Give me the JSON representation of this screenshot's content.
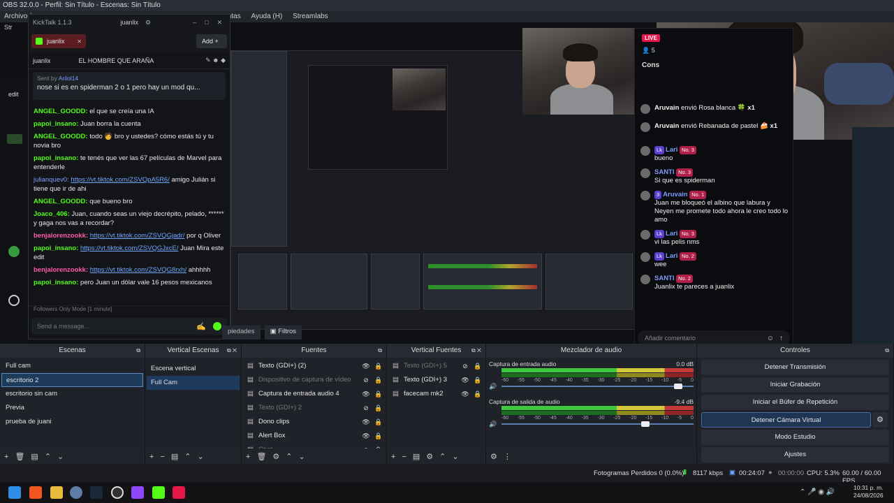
{
  "obs": {
    "title": "OBS 32.0.0 - Perfil: Sin Título - Escenas: Sin Título",
    "menu": [
      "Archivo (",
      "entas",
      "Ayuda (H)",
      "Streamlabs"
    ],
    "menu_partial_left": "Str",
    "preview_labels": {
      "edit_left": "edit"
    }
  },
  "kicktalk": {
    "title": "KickTalk 1.1.3",
    "user": "juanlix",
    "tab": "juanlix",
    "add": "Add",
    "channel": "juanlix",
    "stream_title": "EL HOMBRE QUE ARAÑA",
    "pinned_from_label": "Sent by",
    "pinned_from_user": "Arilol14",
    "pinned_text": "nose si es en spiderman 2 o 1 pero hay un mod qu...",
    "messages": [
      {
        "user": "ANGEL_GOODD:",
        "text": "el que se creía una IA",
        "link": ""
      },
      {
        "user": "papoi_insano:",
        "text": "Juan borra la cuenta",
        "link": ""
      },
      {
        "user": "ANGEL_GOODD:",
        "text": "todo 🧑 bro y ustedes? cómo estás tú y tu novia bro",
        "link": ""
      },
      {
        "user": "papoi_insano:",
        "text": "te tenés que ver las 67 películas de Marvel para entenderle",
        "link": ""
      },
      {
        "user": "julianquev0:",
        "text": "amigo Julián si tiene que ir de ahi",
        "link": "https://vt.tiktok.com/ZSVQpA5R6/"
      },
      {
        "user": "ANGEL_GOODD:",
        "text": "que bueno bro",
        "link": ""
      },
      {
        "user": "Joaco_406:",
        "text": "Juan, cuando seas un viejo decrépito, pelado, ****** y gaga nos vas a recordar?",
        "link": ""
      },
      {
        "user": "benjalorenzookk:",
        "text": "por q Oliver",
        "link": "https://vt.tiktok.com/ZSVQGjadr/"
      },
      {
        "user": "papoi_insano:",
        "text": "Juan Mira este edit",
        "link": "https://vt.tiktok.com/ZSVQGJxcE/"
      },
      {
        "user": "benjalorenzookk:",
        "text": "ahhhhh",
        "link": "https://vt.tiktok.com/ZSVQG8rxh/"
      },
      {
        "user": "papoi_insano:",
        "text": "pero Juan un dólar vale 16 pesos mexicanos",
        "link": ""
      }
    ],
    "followers_mode": "Followers Only Mode [1 minute]",
    "input_placeholder": "Send a message..."
  },
  "kick_chat": {
    "live_badge": "LIVE",
    "viewers": "5",
    "partial_title": "Cons",
    "gift1_user": "Aruvain",
    "gift1_text": "envió Rosa blanca",
    "gift1_count": "x1",
    "gift2_user": "Aruvain",
    "gift2_text": "envió Rebanada de pastel",
    "gift2_count": "x1",
    "messages": [
      {
        "user": "Lari",
        "badge": "Lk",
        "rank": "No. 3",
        "text": "bueno"
      },
      {
        "user": "SANTI",
        "badge": "",
        "rank": "No. 3",
        "text": "Si que es spiderman"
      },
      {
        "user": "Aruvain",
        "badge": "3",
        "rank": "No. 1",
        "text": "Juan me bloqueó el albino que labura y Neyen me promete todo ahora le creo todo lo amo"
      },
      {
        "user": "Lari",
        "badge": "Lk",
        "rank": "No. 3",
        "text": "vi las pelis nms"
      },
      {
        "user": "Lari",
        "badge": "Lk",
        "rank": "No. 2",
        "text": "wee"
      },
      {
        "user": "SANTI",
        "badge": "",
        "rank": "No. 2",
        "text": "Juanlix te pareces a juanlix"
      }
    ],
    "comment_placeholder": "Añadir comentario"
  },
  "preview_tabs": {
    "properties": "piedades",
    "filters": "Filtros"
  },
  "docks": {
    "scenes_title": "Escenas",
    "scenes": [
      "Full cam",
      "escritorio 2",
      "escritorio sin cam",
      "Previa",
      "prueba de juani"
    ],
    "selected_scene_index": 1,
    "vscenes_title": "Vertical Escenas",
    "vscenes": [
      "Escena vertical",
      "Full Cam"
    ],
    "sources_title": "Fuentes",
    "sources": [
      {
        "label": "Texto (GDI+) (2)",
        "dim": false
      },
      {
        "label": "Dispositivo de captura de vídeo",
        "dim": true
      },
      {
        "label": "Captura de entrada audio 4",
        "dim": false
      },
      {
        "label": "Texto (GDI+) 2",
        "dim": true
      },
      {
        "label": "Dono clips",
        "dim": false
      },
      {
        "label": "Alert Box",
        "dim": false
      },
      {
        "label": "Chat",
        "dim": true
      }
    ],
    "vsources_title": "Vertical Fuentes",
    "vsources": [
      {
        "label": "Texto (GDI+) 5",
        "dim": true
      },
      {
        "label": "Texto (GDI+) 3",
        "dim": false
      },
      {
        "label": "facecam mk2",
        "dim": false
      }
    ],
    "mixer_title": "Mezclador de audio",
    "mixer": [
      {
        "name": "Captura de entrada audio",
        "db": "0.0 dB",
        "level": 0.92
      },
      {
        "name": "Captura de salida de audio",
        "db": "-9.4 dB",
        "level": 0.75
      }
    ],
    "scale": [
      "-60",
      "-55",
      "-50",
      "-45",
      "-40",
      "-35",
      "-30",
      "-25",
      "-20",
      "-15",
      "-10",
      "-5",
      "0"
    ],
    "controls_title": "Controles",
    "controls": [
      "Detener Transmisión",
      "Iniciar Grabación",
      "Iniciar el Búfer de Repetición",
      "Detener Cámara Virtual",
      "Modo Estudio",
      "Ajustes"
    ]
  },
  "status": {
    "dropped": "Fotogramas Perdidos 0 (0.0%)",
    "kbps": "8117 kbps",
    "live_time": "00:24:07",
    "rec_time": "00:00:00",
    "cpu": "CPU: 5.3%",
    "fps": "60.00 / 60.00 FPS"
  },
  "taskbar": {
    "time": "10:31 p. m.",
    "date": "24/08/2026"
  },
  "colors": {
    "kick_green": "#53fc18",
    "accent_blue": "#5d8fc7",
    "obs_bg": "#20222a"
  }
}
